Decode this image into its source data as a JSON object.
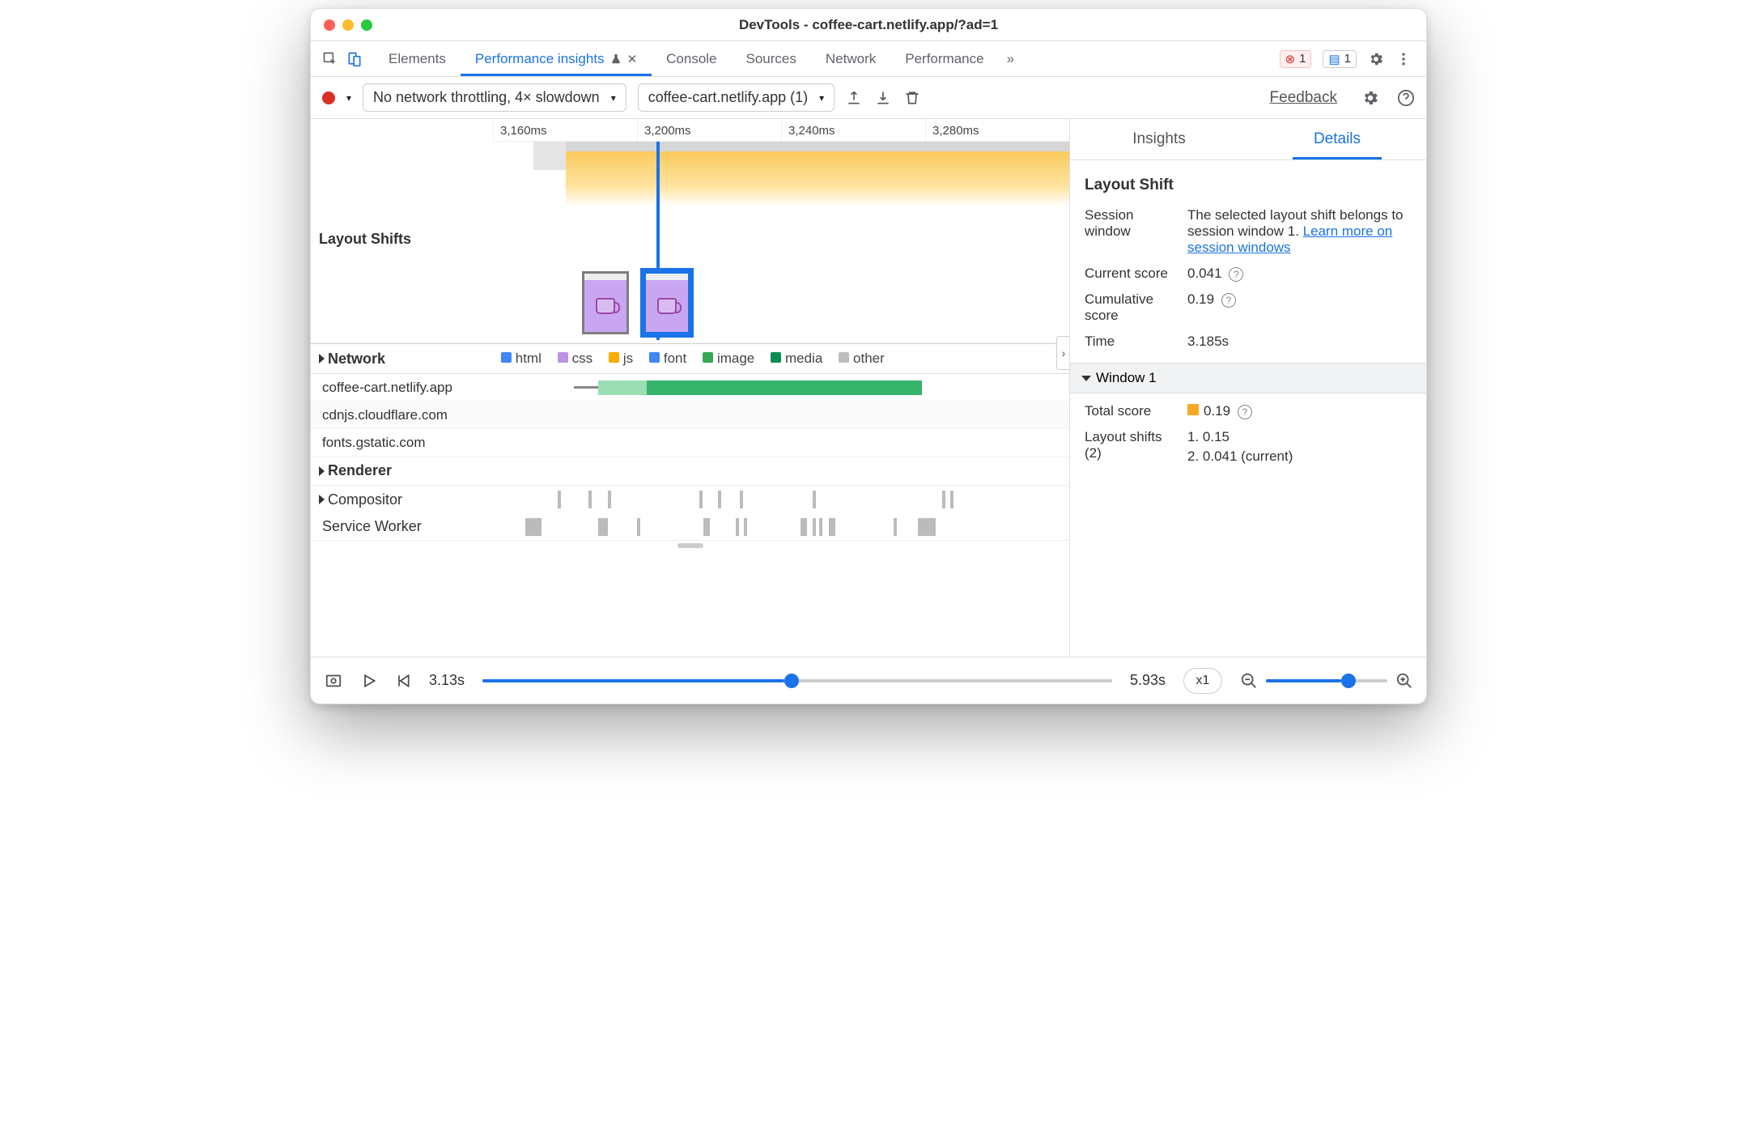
{
  "title": "DevTools - coffee-cart.netlify.app/?ad=1",
  "tabs": [
    "Elements",
    "Performance insights",
    "Console",
    "Sources",
    "Network",
    "Performance"
  ],
  "activeTabIndex": 1,
  "errorBadge": "1",
  "msgBadge": "1",
  "throttle": "No network throttling, 4× slowdown",
  "recording": "coffee-cart.netlify.app (1)",
  "feedback": "Feedback",
  "ruler": [
    "3,160ms",
    "3,200ms",
    "3,240ms",
    "3,280ms"
  ],
  "layoutShiftsLabel": "Layout Shifts",
  "networkLabel": "Network",
  "legendItems": [
    {
      "color": "#4285f4",
      "label": "html"
    },
    {
      "color": "#bd91e3",
      "label": "css"
    },
    {
      "color": "#f9ab00",
      "label": "js"
    },
    {
      "color": "#4285f4",
      "label": "font"
    },
    {
      "color": "#34a853",
      "label": "image"
    },
    {
      "color": "#0d8a53",
      "label": "media"
    },
    {
      "color": "#bdbdbd",
      "label": "other"
    }
  ],
  "netRows": [
    "coffee-cart.netlify.app",
    "cdnjs.cloudflare.com",
    "fonts.gstatic.com"
  ],
  "rendererLabel": "Renderer",
  "compositorLabel": "Compositor",
  "swLabel": "Service Worker",
  "rtabs": [
    "Insights",
    "Details"
  ],
  "activeRtab": 1,
  "detailsTitle": "Layout Shift",
  "sessionKey": "Session window",
  "sessionVal": "The selected layout shift belongs to session window 1. ",
  "sessionLink": "Learn more on session windows",
  "currentScoreKey": "Current score",
  "currentScoreVal": "0.041",
  "cumScoreKey": "Cumulative score",
  "cumScoreVal": "0.19",
  "timeKey": "Time",
  "timeVal": "3.185s",
  "windowHeader": "Window 1",
  "totalScoreKey": "Total score",
  "totalScoreVal": "0.19",
  "lsKey": "Layout shifts (2)",
  "ls1": "1. 0.15",
  "ls2": "2. 0.041 (current)",
  "bottomTime1": "3.13s",
  "bottomTime2": "5.93s",
  "speed": "x1"
}
